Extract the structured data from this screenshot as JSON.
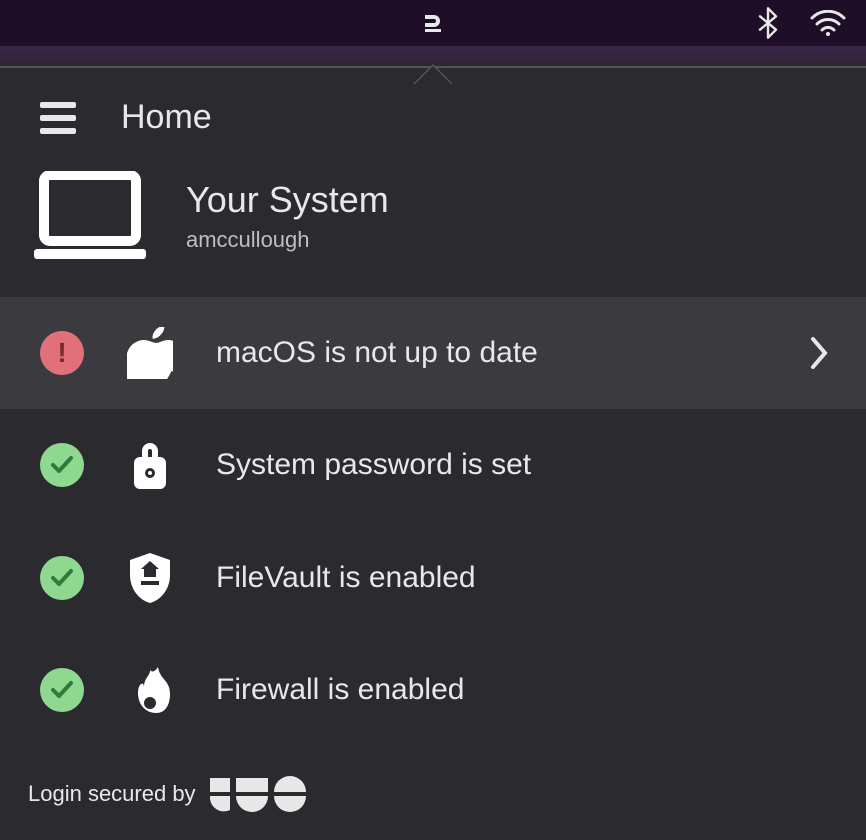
{
  "header": {
    "title": "Home"
  },
  "system": {
    "title": "Your System",
    "username": "amccullough"
  },
  "checks": [
    {
      "status": "warn",
      "icon": "apple",
      "label": "macOS is not up to date",
      "actionable": true
    },
    {
      "status": "ok",
      "icon": "lock",
      "label": "System password is set",
      "actionable": false
    },
    {
      "status": "ok",
      "icon": "shield",
      "label": "FileVault is enabled",
      "actionable": false
    },
    {
      "status": "ok",
      "icon": "flame",
      "label": "Firewall is enabled",
      "actionable": false
    }
  ],
  "footer": {
    "text": "Login secured by",
    "brand": "DUO"
  },
  "colors": {
    "warn_bg": "#e2707a",
    "ok_bg": "#8fd88f",
    "panel": "#2b2b2f",
    "highlight": "#3a3a3f"
  }
}
